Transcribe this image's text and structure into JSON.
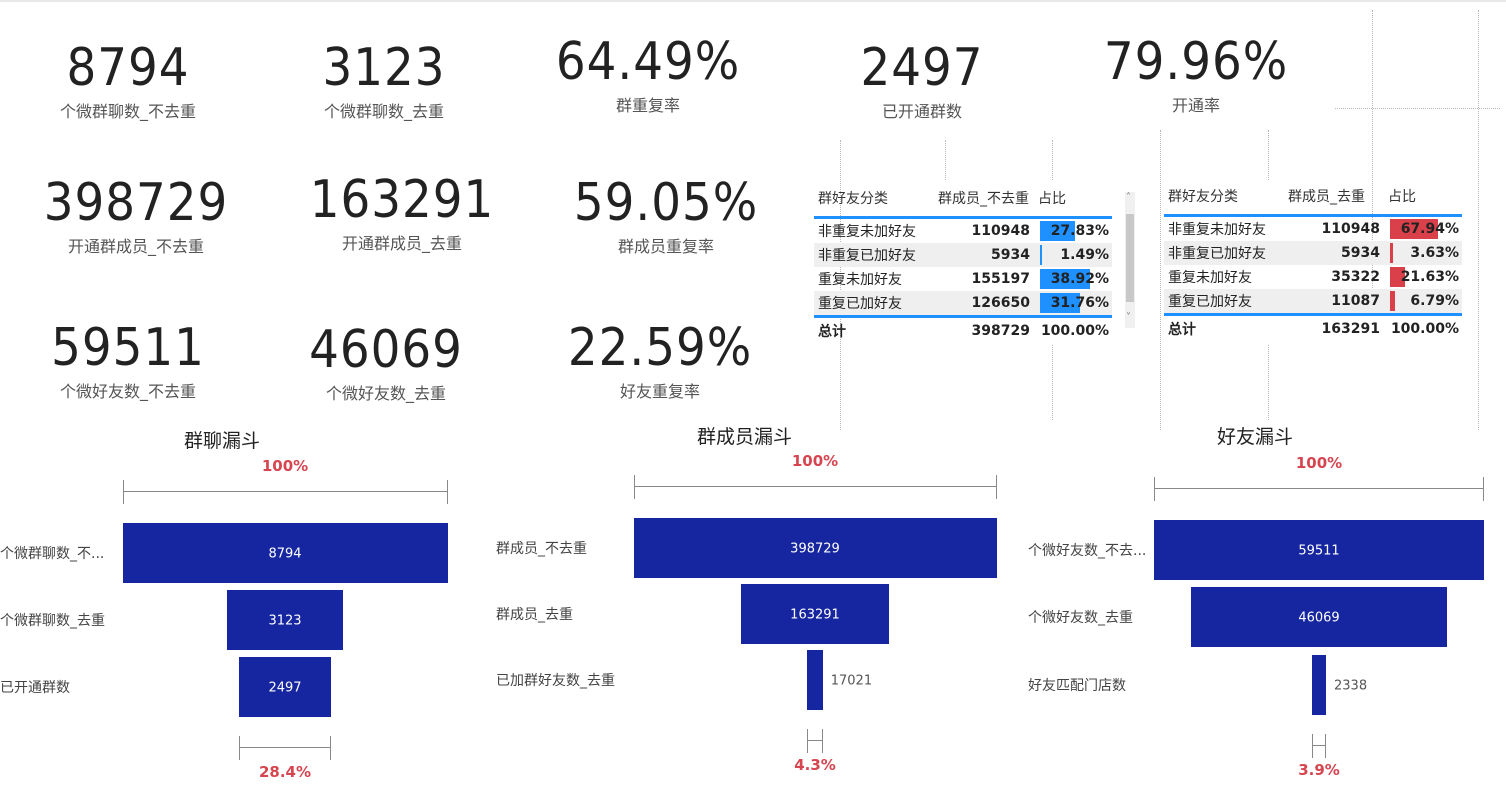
{
  "kpis": [
    {
      "value": "8794",
      "label": "个微群聊数_不去重"
    },
    {
      "value": "3123",
      "label": "个微群聊数_去重"
    },
    {
      "value": "64.49%",
      "label": "群重复率"
    },
    {
      "value": "2497",
      "label": "已开通群数"
    },
    {
      "value": "79.96%",
      "label": "开通率"
    },
    {
      "value": "398729",
      "label": "开通群成员_不去重"
    },
    {
      "value": "163291",
      "label": "开通群成员_去重"
    },
    {
      "value": "59.05%",
      "label": "群成员重复率"
    },
    {
      "value": "59511",
      "label": "个微好友数_不去重"
    },
    {
      "value": "46069",
      "label": "个微好友数_去重"
    },
    {
      "value": "22.59%",
      "label": "好友重复率"
    }
  ],
  "tables": [
    {
      "headers": [
        "群好友分类",
        "群成员_不去重",
        "占比"
      ],
      "bar_color": "#1e90ff",
      "rows": [
        {
          "cat": "非重复未加好友",
          "count": "110948",
          "pct": "27.83%",
          "share": 0.2783
        },
        {
          "cat": "非重复已加好友",
          "count": "5934",
          "pct": "1.49%",
          "share": 0.0149
        },
        {
          "cat": "重复未加好友",
          "count": "155197",
          "pct": "38.92%",
          "share": 0.3892
        },
        {
          "cat": "重复已加好友",
          "count": "126650",
          "pct": "31.76%",
          "share": 0.3176
        }
      ],
      "total": {
        "cat": "总计",
        "count": "398729",
        "pct": "100.00%"
      }
    },
    {
      "headers": [
        "群好友分类",
        "群成员_去重",
        "占比"
      ],
      "bar_color": "#d9404a",
      "rows": [
        {
          "cat": "非重复未加好友",
          "count": "110948",
          "pct": "67.94%",
          "share": 0.6794
        },
        {
          "cat": "非重复已加好友",
          "count": "5934",
          "pct": "3.63%",
          "share": 0.0363
        },
        {
          "cat": "重复未加好友",
          "count": "35322",
          "pct": "21.63%",
          "share": 0.2163
        },
        {
          "cat": "重复已加好友",
          "count": "11087",
          "pct": "6.79%",
          "share": 0.0679
        }
      ],
      "total": {
        "cat": "总计",
        "count": "163291",
        "pct": "100.00%"
      }
    }
  ],
  "chart_data": [
    {
      "type": "funnel",
      "title": "群聊漏斗",
      "categories": [
        "个微群聊数_不...",
        "个微群聊数_去重",
        "已开通群数"
      ],
      "values": [
        8794,
        3123,
        2497
      ],
      "value_labels": [
        "8794",
        "3123",
        "2497"
      ],
      "top_pct": "100%",
      "bottom_pct": "28.4%"
    },
    {
      "type": "funnel",
      "title": "群成员漏斗",
      "categories": [
        "群成员_不去重",
        "群成员_去重",
        "已加群好友数_去重"
      ],
      "values": [
        398729,
        163291,
        17021
      ],
      "value_labels": [
        "398729",
        "163291",
        "17021"
      ],
      "top_pct": "100%",
      "bottom_pct": "4.3%"
    },
    {
      "type": "funnel",
      "title": "好友漏斗",
      "categories": [
        "个微好友数_不去...",
        "个微好友数_去重",
        "好友匹配门店数"
      ],
      "values": [
        59511,
        46069,
        2338
      ],
      "value_labels": [
        "59511",
        "46069",
        "2338"
      ],
      "top_pct": "100%",
      "bottom_pct": "3.9%"
    }
  ],
  "colors": {
    "funnel_bar": "#1625a0",
    "pct_label": "#d64550",
    "table_accent": "#1e90ff"
  }
}
